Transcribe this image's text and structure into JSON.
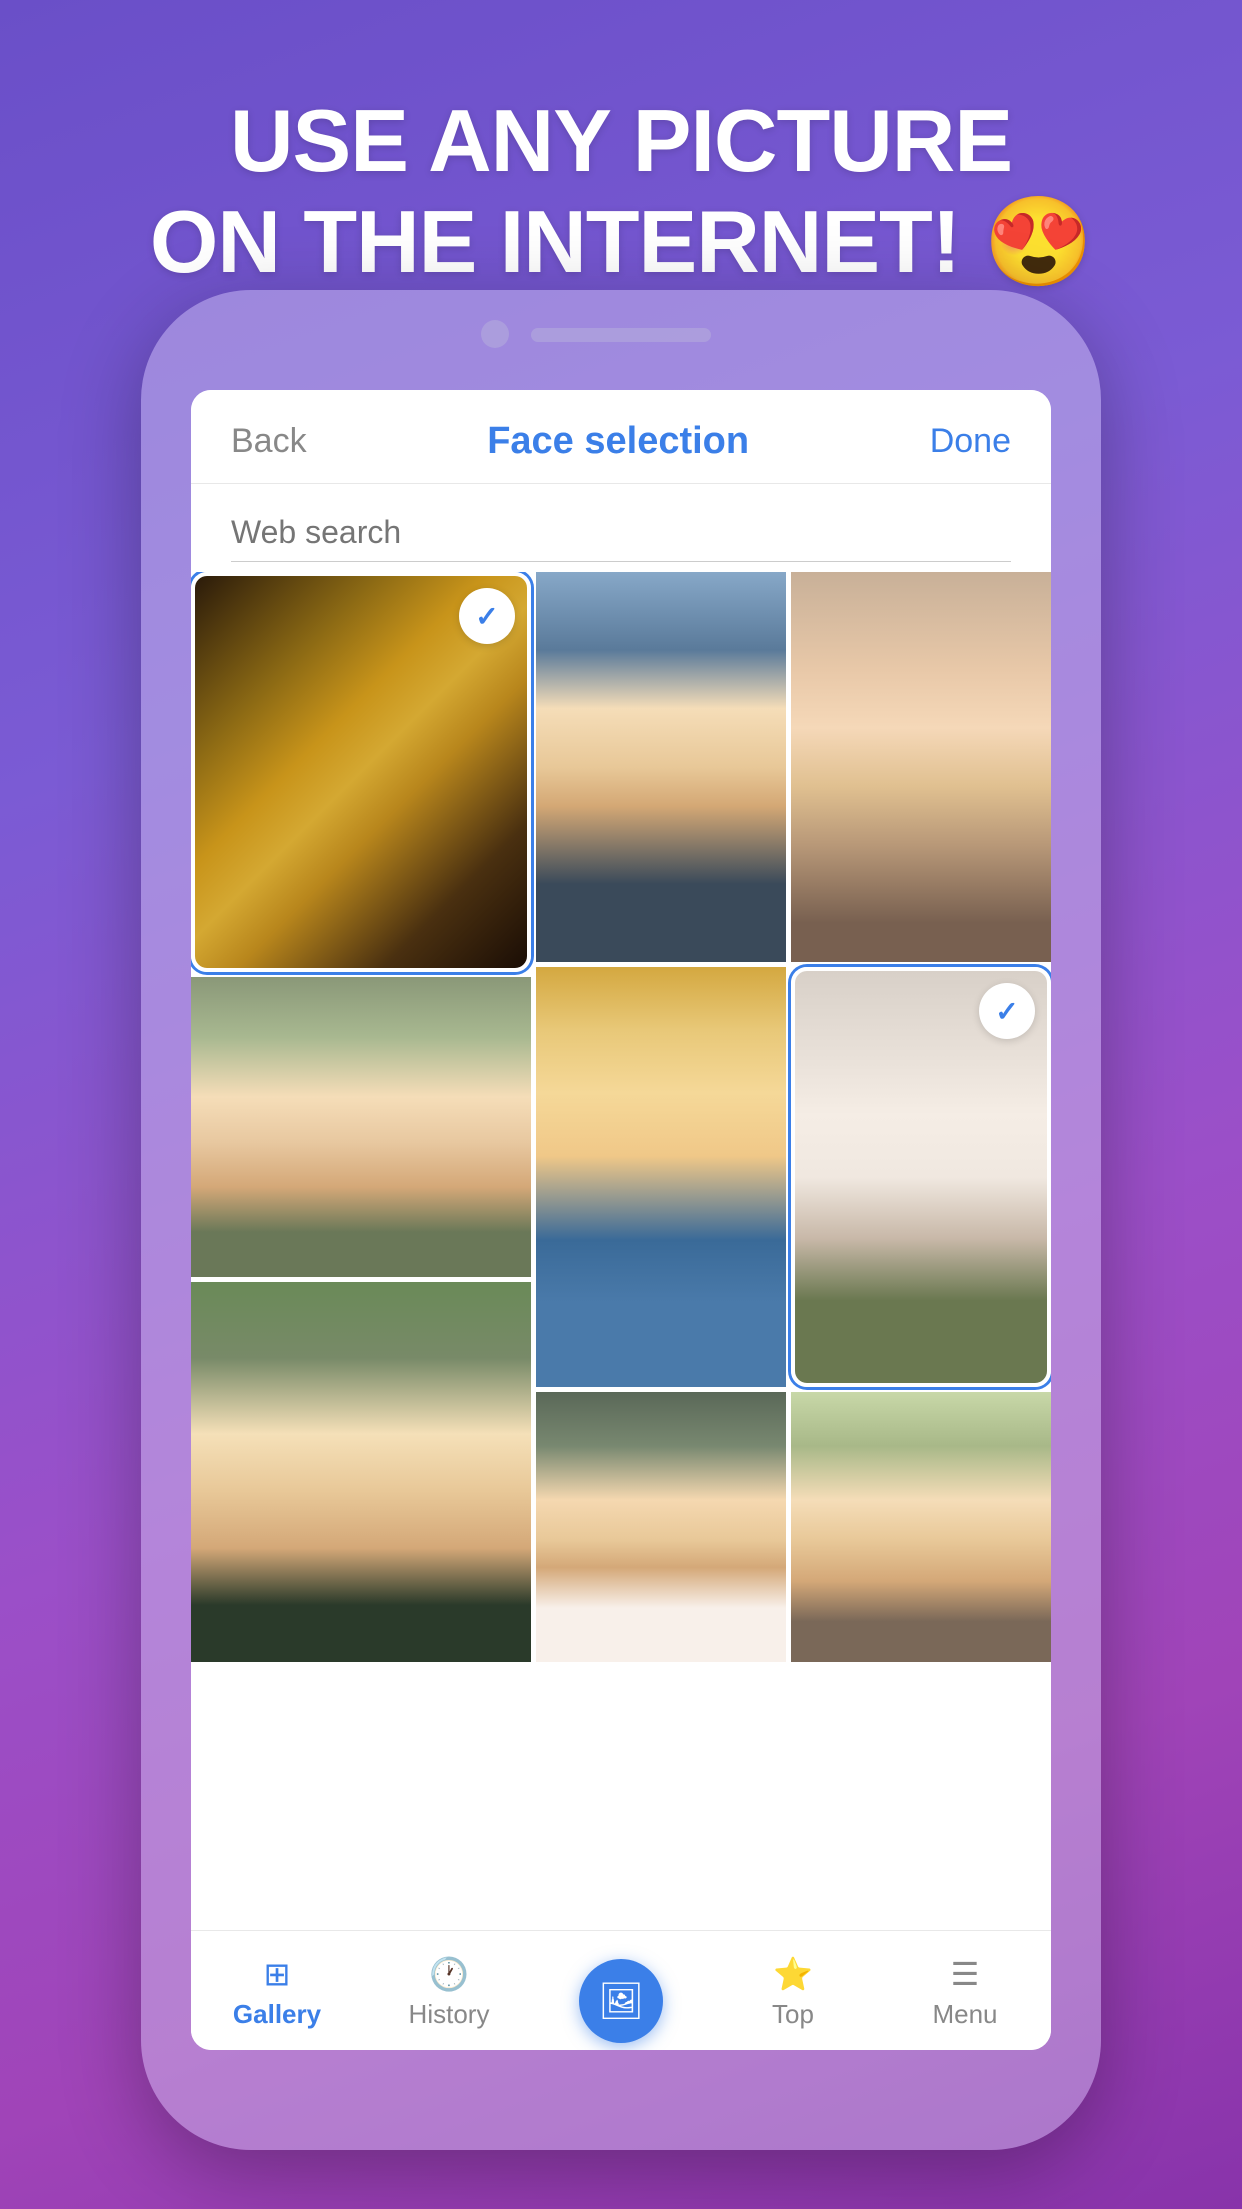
{
  "headline": {
    "line1": "USE ANY PICTURE",
    "line2": "ON THE INTERNET!",
    "emoji": "😍"
  },
  "screen": {
    "topBar": {
      "backLabel": "Back",
      "title": "Face selection",
      "doneLabel": "Done"
    },
    "searchPlaceholder": "Web search",
    "bottomNav": {
      "items": [
        {
          "id": "gallery",
          "label": "Gallery",
          "active": true
        },
        {
          "id": "history",
          "label": "History",
          "active": false
        },
        {
          "id": "add",
          "label": "",
          "active": false
        },
        {
          "id": "top",
          "label": "Top",
          "active": false
        },
        {
          "id": "menu",
          "label": "Menu",
          "active": false
        }
      ]
    }
  }
}
